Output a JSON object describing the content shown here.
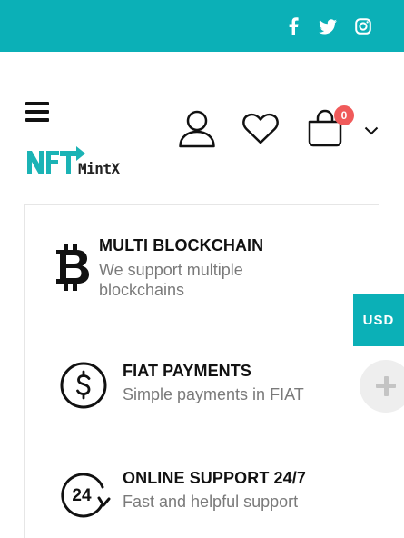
{
  "topbar": {
    "background": "#0bb0b7",
    "social_icons": [
      "facebook-icon",
      "twitter-icon",
      "instagram-icon"
    ]
  },
  "header": {
    "menu_icon": "hamburger-menu-icon",
    "logo": {
      "mark": "NFT",
      "text": "MintX",
      "brand_color": "#1bb3b5"
    },
    "icons": [
      "user-icon",
      "heart-icon",
      "shopping-bag-icon",
      "chevron-down-icon"
    ],
    "cart_count": "0",
    "badge_color": "#f05a5a"
  },
  "features": [
    {
      "icon": "bitcoin-icon",
      "title": "MULTI BLOCKCHAIN",
      "desc_line1": "We support multiple",
      "desc_line2": "blockchains"
    },
    {
      "icon": "dollar-circle-icon",
      "title": "FIAT PAYMENTS",
      "desc_line1": "Simple payments in FIAT"
    },
    {
      "icon": "support-24-icon",
      "icon_text": "24",
      "title": "ONLINE SUPPORT 24/7",
      "desc_line1": "Fast and helpful support"
    }
  ],
  "currency_button": {
    "label": "USD"
  },
  "floating_button": {
    "icon": "plus-icon"
  }
}
